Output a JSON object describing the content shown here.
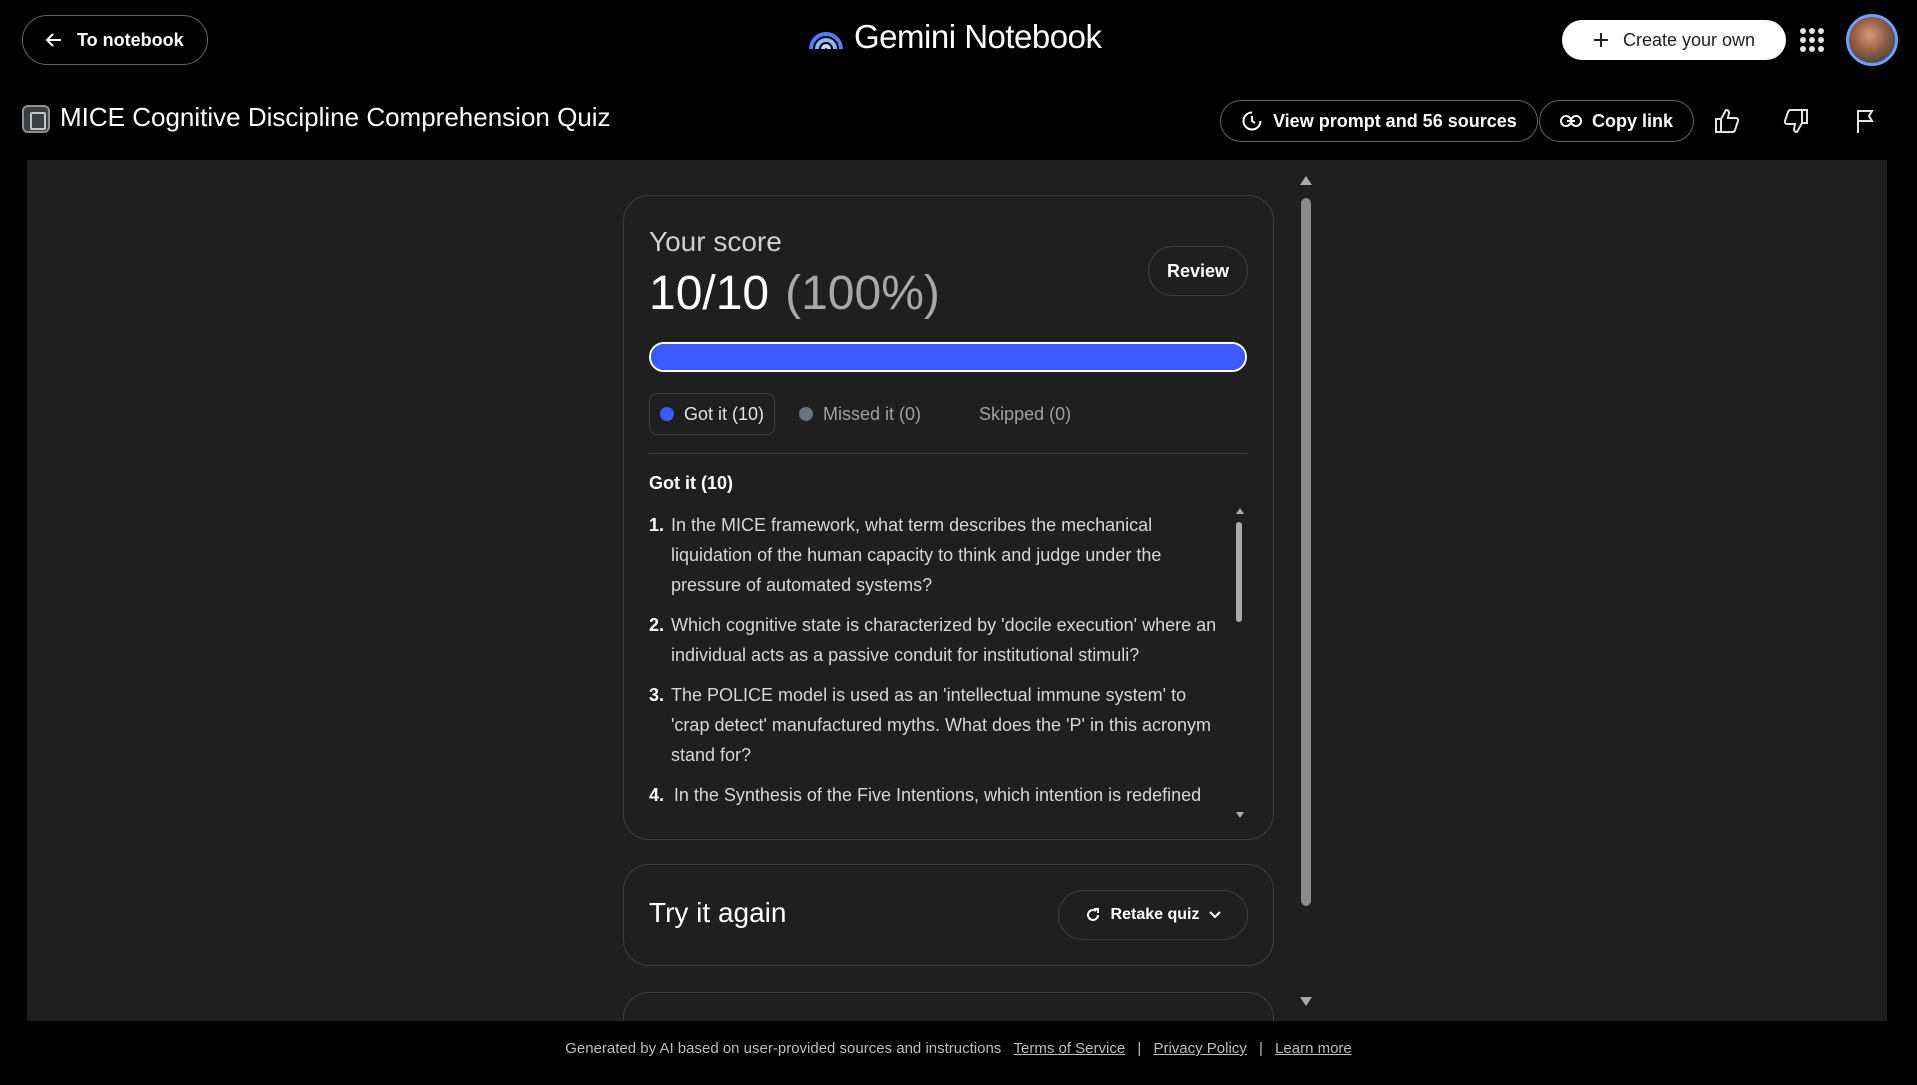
{
  "topbar": {
    "back_label": "To notebook",
    "logo_text": "Gemini Notebook",
    "create_label": "Create your own"
  },
  "titlebar": {
    "title": "MICE Cognitive Discipline Comprehension Quiz",
    "view_prompt_label": "View prompt and 56 sources",
    "copy_link_label": "Copy link"
  },
  "score": {
    "label": "Your score",
    "value": "10/10",
    "percent": "(100%)",
    "review_label": "Review",
    "progress_fraction": 1.0
  },
  "filters": [
    {
      "label": "Got it (10)",
      "color": "#3d5afe"
    },
    {
      "label": "Missed it (0)",
      "color": "#6b7280"
    },
    {
      "label": "Skipped (0)",
      "color": "#1f1f1f"
    }
  ],
  "section_title": "Got it (10)",
  "questions": [
    {
      "num": "1.",
      "text": "In the MICE framework, what term describes the mechanical liquidation of the human capacity to think and judge under the pressure of automated systems?"
    },
    {
      "num": "2.",
      "text": "Which cognitive state is characterized by 'docile execution' where an individual acts as a passive conduit for institutional stimuli?"
    },
    {
      "num": "3.",
      "text": "The POLICE model is used as an 'intellectual immune system' to 'crap detect' manufactured myths. What does the 'P' in this acronym stand for?"
    },
    {
      "num": "4.",
      "text": "In the Synthesis of the Five Intentions, which intention is redefined as"
    }
  ],
  "retry": {
    "title": "Try it again",
    "retake_label": "Retake quiz"
  },
  "footer": {
    "text": "Generated by AI based on user-provided sources and instructions",
    "terms": "Terms of Service",
    "privacy": "Privacy Policy",
    "learn": "Learn more",
    "sep": "|"
  },
  "colors": {
    "accent": "#3d5afe",
    "background": "#000000",
    "panel": "#1f1f1f"
  }
}
